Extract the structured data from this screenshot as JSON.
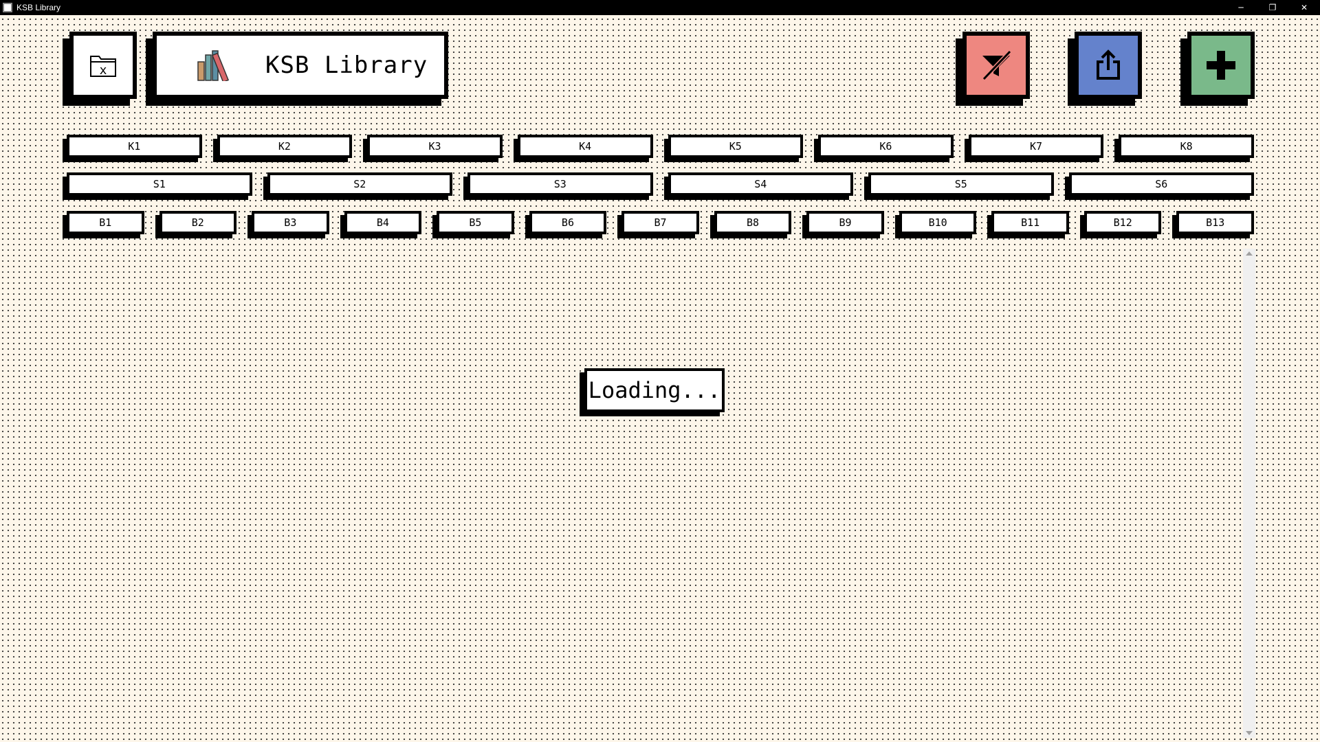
{
  "window": {
    "title": "KSB Library",
    "controls": {
      "minimize": "─",
      "restore": "❐",
      "close": "✕"
    }
  },
  "header": {
    "logo_title": "KSB Library",
    "close_icon": "folder-x-icon",
    "close_glyph": "x",
    "logo_icon": "books-icon",
    "actions": [
      {
        "name": "clear-filter-button",
        "icon": "filter-off-icon",
        "color": "#ee8780"
      },
      {
        "name": "export-button",
        "icon": "share-export-icon",
        "color": "#6482cc"
      },
      {
        "name": "add-button",
        "icon": "plus-icon",
        "color": "#7ab98a"
      }
    ]
  },
  "filters": {
    "k_row": [
      "K1",
      "K2",
      "K3",
      "K4",
      "K5",
      "K6",
      "K7",
      "K8"
    ],
    "s_row": [
      "S1",
      "S2",
      "S3",
      "S4",
      "S5",
      "S6"
    ],
    "b_row": [
      "B1",
      "B2",
      "B3",
      "B4",
      "B5",
      "B6",
      "B7",
      "B8",
      "B9",
      "B10",
      "B11",
      "B12",
      "B13"
    ]
  },
  "main": {
    "loading_text": "Loading..."
  }
}
